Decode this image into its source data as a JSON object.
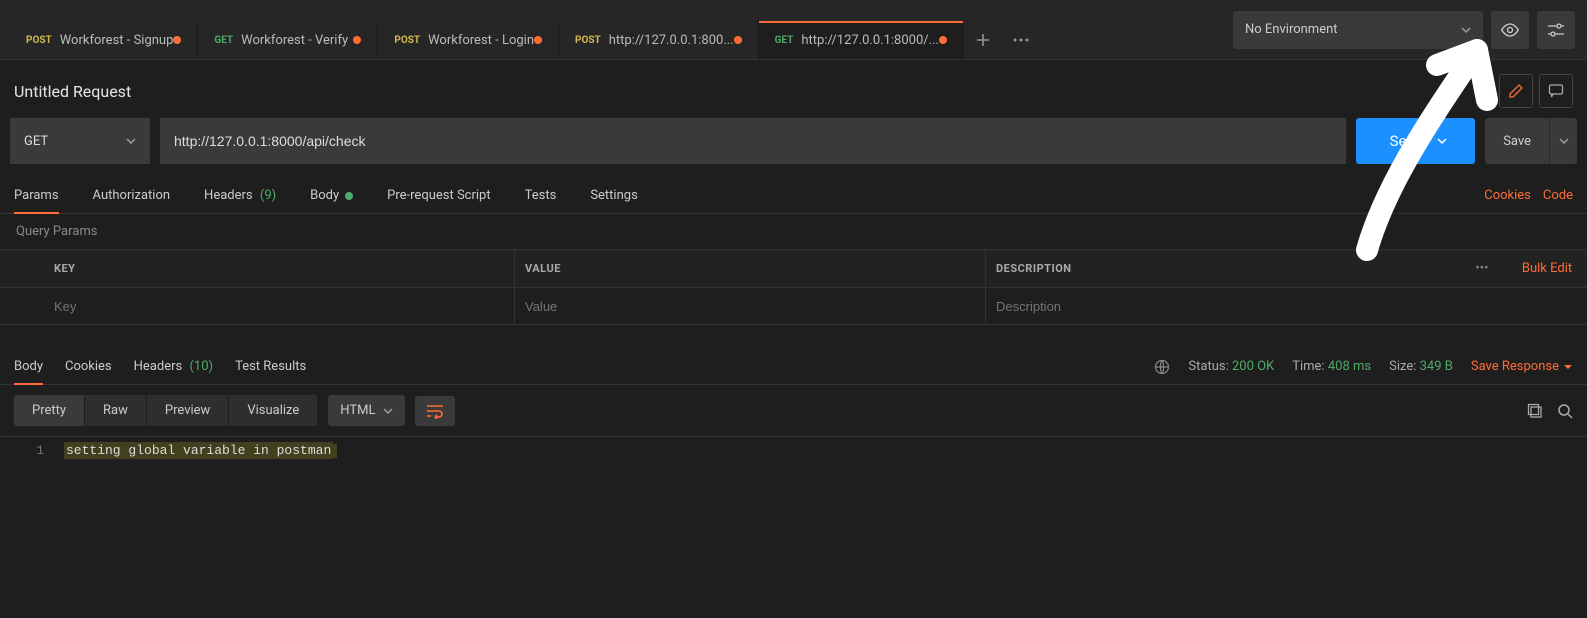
{
  "tabs": [
    {
      "method": "POST",
      "mclass": "m-post",
      "name": "Workforest - Signup",
      "dirty": true
    },
    {
      "method": "GET",
      "mclass": "m-get",
      "name": "Workforest - Verify",
      "dirty": true
    },
    {
      "method": "POST",
      "mclass": "m-post",
      "name": "Workforest - Login",
      "dirty": true
    },
    {
      "method": "POST",
      "mclass": "m-post",
      "name": "http://127.0.0.1:800...",
      "dirty": true
    },
    {
      "method": "GET",
      "mclass": "m-get",
      "name": "http://127.0.0.1:8000/...",
      "dirty": true,
      "active": true
    }
  ],
  "environment": {
    "label": "No Environment"
  },
  "request": {
    "title": "Untitled Request",
    "method": "GET",
    "url": "http://127.0.0.1:8000/api/check",
    "send": "Send",
    "save": "Save"
  },
  "reqTabs": {
    "params": "Params",
    "auth": "Authorization",
    "headers": "Headers",
    "headersCount": "(9)",
    "body": "Body",
    "prereq": "Pre-request Script",
    "tests": "Tests",
    "settings": "Settings",
    "cookies": "Cookies",
    "code": "Code"
  },
  "queryParams": {
    "label": "Query Params",
    "headers": {
      "key": "KEY",
      "value": "VALUE",
      "desc": "DESCRIPTION"
    },
    "placeholders": {
      "key": "Key",
      "value": "Value",
      "desc": "Description"
    },
    "bulk": "Bulk Edit"
  },
  "response": {
    "tabs": {
      "body": "Body",
      "cookies": "Cookies",
      "headers": "Headers",
      "headersCount": "(10)",
      "tests": "Test Results"
    },
    "status": {
      "label": "Status:",
      "value": "200 OK"
    },
    "time": {
      "label": "Time:",
      "value": "408 ms"
    },
    "size": {
      "label": "Size:",
      "value": "349 B"
    },
    "saveResponse": "Save Response"
  },
  "view": {
    "pretty": "Pretty",
    "raw": "Raw",
    "preview": "Preview",
    "visualize": "Visualize",
    "type": "HTML"
  },
  "code": {
    "lineNo": "1",
    "text": "setting global variable in postman"
  }
}
